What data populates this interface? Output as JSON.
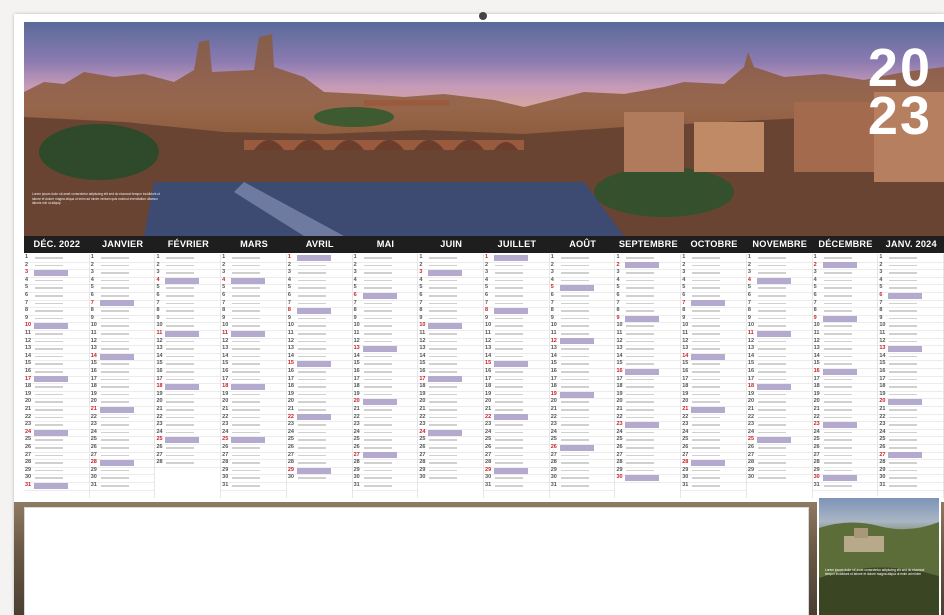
{
  "calendar": {
    "year_top": "20",
    "year_bottom": "23",
    "months": [
      "DÉC. 2022",
      "JANVIER",
      "FÉVRIER",
      "MARS",
      "AVRIL",
      "MAI",
      "JUIN",
      "JUILLET",
      "AOÛT",
      "SEPTEMBRE",
      "OCTOBRE",
      "NOVEMBRE",
      "DÉCEMBRE",
      "JANV. 2024"
    ],
    "days_in_month": [
      31,
      31,
      28,
      31,
      30,
      31,
      30,
      31,
      31,
      30,
      31,
      30,
      31,
      31
    ],
    "first_weekday": [
      4,
      0,
      3,
      3,
      6,
      1,
      4,
      6,
      2,
      5,
      0,
      3,
      5,
      1
    ],
    "accent_red": "#c91f24",
    "band_color": "#b3aacd"
  },
  "photo": {
    "caption": "Lorem ipsum dolor sit amet consectetur adipiscing elit sed do eiusmod tempor incididunt ut labore et dolore magna aliqua ut enim ad minim veniam quis nostrud exercitation ullamco laboris nisi ut aliquip"
  },
  "inset": {
    "caption": "Lorem ipsum dolor sit amet consectetur adipiscing elit sed do eiusmod tempor incididunt ut labore et dolore magna aliqua ut enim ad minim"
  }
}
